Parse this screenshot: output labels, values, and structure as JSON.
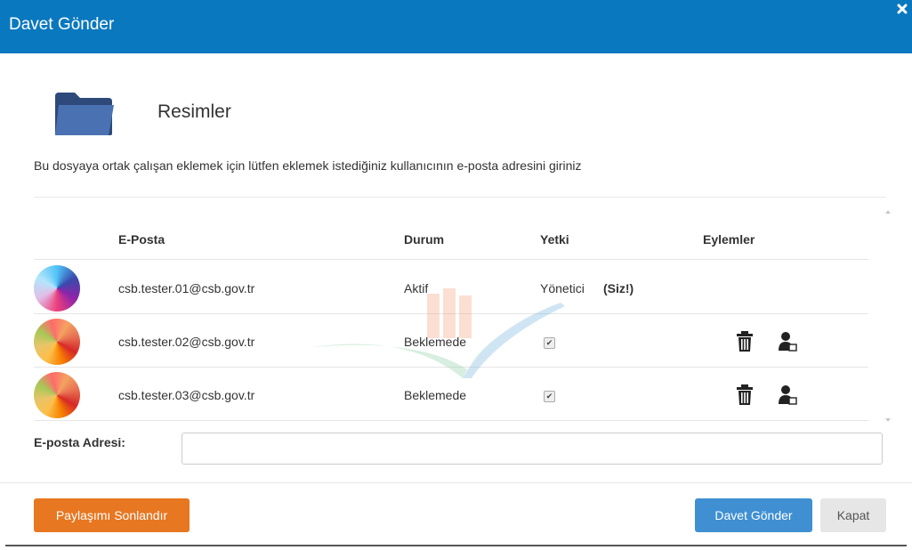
{
  "header": {
    "title": "Davet Gönder"
  },
  "folder": {
    "name": "Resimler",
    "icon": "folder-icon"
  },
  "instruction": "Bu dosyaya ortak çalışan eklemek için lütfen eklemek istediğiniz kullanıcının e-posta adresini giriniz",
  "table": {
    "columns": {
      "email": "E-Posta",
      "status": "Durum",
      "permission": "Yetki",
      "actions": "Eylemler"
    },
    "rows": [
      {
        "email": "csb.tester.01@csb.gov.tr",
        "status": "Aktif",
        "permission": "Yönetici",
        "note": "(Siz!)"
      },
      {
        "email": "csb.tester.02@csb.gov.tr",
        "status": "Beklemede",
        "permission_checked": true,
        "check": "✔"
      },
      {
        "email": "csb.tester.03@csb.gov.tr",
        "status": "Beklemede",
        "permission_checked": true,
        "check": "✔"
      }
    ]
  },
  "form": {
    "email_label": "E-posta Adresi:",
    "email_value": ""
  },
  "footer": {
    "end_share_label": "Paylaşımı Sonlandır",
    "send_label": "Davet Gönder",
    "close_label": "Kapat"
  },
  "colors": {
    "header_bg": "#0a78bf",
    "end_share_bg": "#e87722",
    "send_bg": "#3f8fd2",
    "close_bg": "#e6e6e6"
  }
}
